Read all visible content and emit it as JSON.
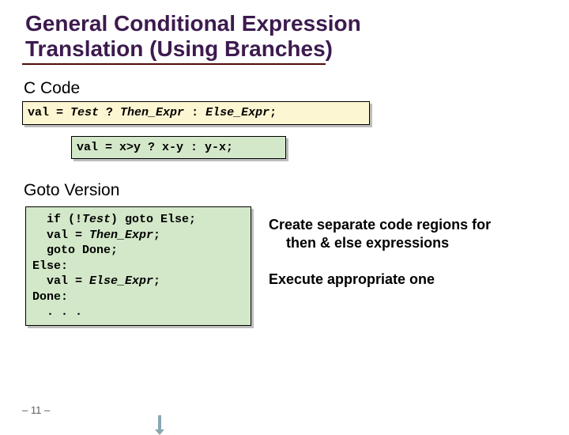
{
  "title_line1": "General Conditional Expression",
  "title_line2": " Translation (Using Branches)",
  "section_c": "C Code",
  "section_goto": "Goto Version",
  "code1": {
    "pre": "val = ",
    "test": "Test",
    "mid1": " ? ",
    "then": "Then_Expr",
    "mid2": " : ",
    "else": "Else_Expr",
    "end": ";"
  },
  "code2": "val = x>y ? x-y : y-x;",
  "code3": {
    "l1a": "  if (!",
    "l1b": "Test",
    "l1c": ") goto Else;",
    "l2a": "  val = ",
    "l2b": "Then_Expr",
    "l2c": ";",
    "l3": "  goto Done;",
    "l4": "Else:",
    "l5a": "  val = ",
    "l5b": "Else_Expr",
    "l5c": ";",
    "l6": "Done:",
    "l7": "  . . ."
  },
  "bullet1a": "Create separate code regions for",
  "bullet1b": "then & else expressions",
  "bullet2": "Execute appropriate one",
  "pagenum": "– 11 –"
}
